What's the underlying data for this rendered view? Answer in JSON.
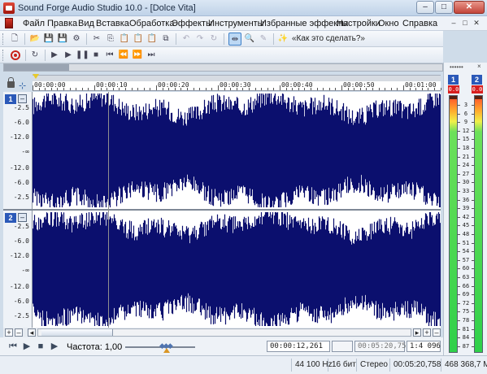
{
  "window": {
    "title": "Sound Forge Audio Studio 10.0 - [Dolce Vita]",
    "controls": [
      "–",
      "□",
      "✕"
    ]
  },
  "menu": {
    "items": [
      "Файл",
      "Правка",
      "Вид",
      "Вставка",
      "Обработка",
      "Эффекты",
      "Инструменты",
      "Избранные эффекты",
      "Настройки",
      "Окно",
      "Справка"
    ]
  },
  "toolbar_main": {
    "howto_label": "«Как это сделать?»"
  },
  "ruler": {
    "labels": [
      "00:00:00",
      "00:00:10",
      "00:00:20",
      "00:00:30",
      "00:00:40",
      "00:00:50",
      "00:01:00"
    ]
  },
  "channels": [
    {
      "number": "1",
      "scale": [
        "-2.5",
        "-6.0",
        "-12.0",
        "-∞",
        "-12.0",
        "-6.0",
        "-2.5"
      ]
    },
    {
      "number": "2",
      "scale": [
        "-2.5",
        "-6.0",
        "-12.0",
        "-∞",
        "-12.0",
        "-6.0",
        "-2.5"
      ]
    }
  ],
  "transport": {
    "rate_label": "Частота: 1,00",
    "position": "00:00:12,261",
    "selection_end": "00:05:20,758",
    "zoom": "1:4 096"
  },
  "status": {
    "sample_rate": "44 100 Hz",
    "bit_depth": "16 бит",
    "channels": "Стерео",
    "length": "00:05:20,758",
    "size": "468 368,7 Мб"
  },
  "meter": {
    "dots": "••••••",
    "close": "×",
    "channels": [
      "1",
      "2"
    ],
    "peaks": [
      "0.0",
      "0.0"
    ],
    "scale": [
      "3",
      "6",
      "9",
      "12",
      "15",
      "18",
      "21",
      "24",
      "27",
      "30",
      "33",
      "36",
      "39",
      "42",
      "45",
      "48",
      "51",
      "54",
      "57",
      "60",
      "63",
      "66",
      "69",
      "72",
      "75",
      "78",
      "81",
      "84",
      "87"
    ]
  },
  "colors": {
    "waveform": "#0b0f6e",
    "channel_badge": "#2b59b8",
    "peak": "#d81e1e"
  }
}
